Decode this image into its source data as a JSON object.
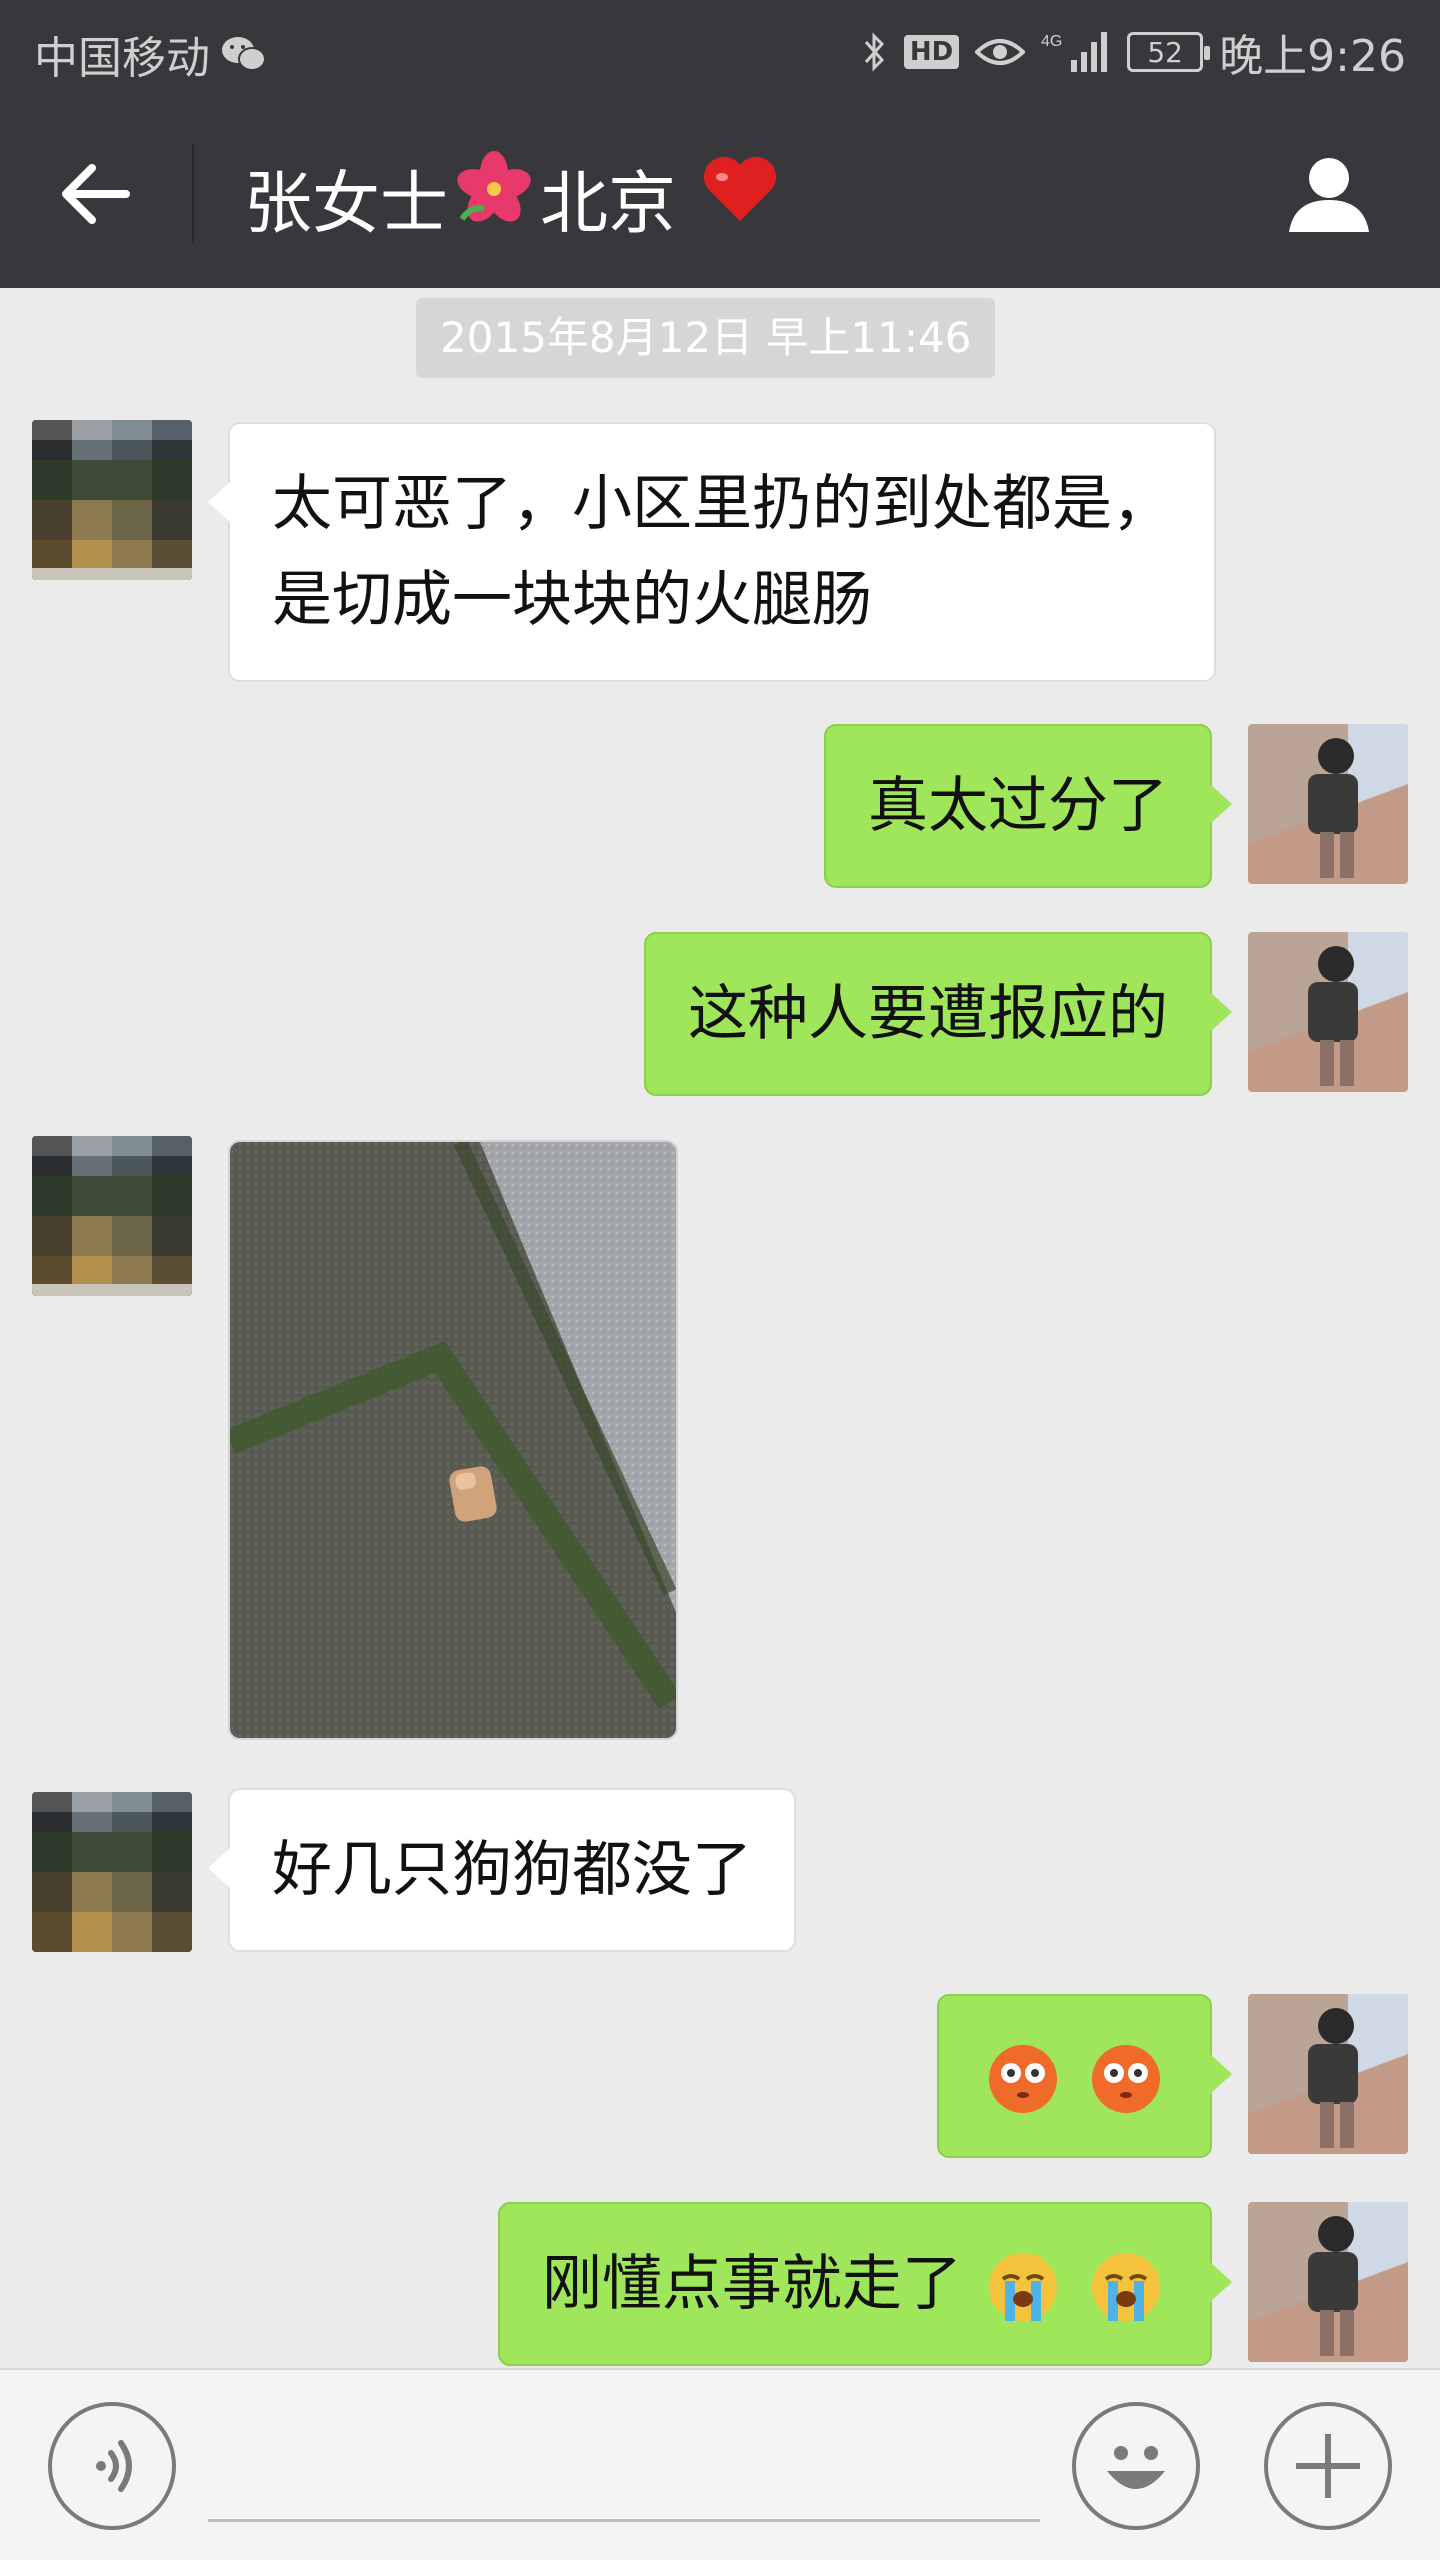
{
  "status_bar": {
    "carrier": "中国移动",
    "network": "4G",
    "battery": "52",
    "time": "晚上9:26",
    "icons": [
      "wechat-icon",
      "bluetooth-icon",
      "hd-icon",
      "eye-icon",
      "signal-icon",
      "battery-icon"
    ]
  },
  "header": {
    "title_part1": "张女士",
    "title_part2": "北京",
    "icons": [
      "back-arrow-icon",
      "hibiscus-icon",
      "heart-icon",
      "profile-icon"
    ]
  },
  "chat": {
    "timestamp": "2015年8月12日 早上11:46",
    "messages": [
      {
        "from": "contact",
        "line1": "太可恶了，小区里扔的到处都是，",
        "line2": "是切成一块块的火腿肠"
      },
      {
        "from": "me",
        "text": "真太过分了"
      },
      {
        "from": "me",
        "text": "这种人要遭报应的"
      },
      {
        "from": "contact",
        "type": "image",
        "description": "photo"
      },
      {
        "from": "contact",
        "text": "好几只狗狗都没了"
      },
      {
        "from": "me",
        "type": "emoji",
        "emojis": [
          "flushed-face-icon",
          "flushed-face-icon"
        ]
      },
      {
        "from": "me",
        "text": "刚懂点事就走了",
        "emojis": [
          "crying-face-icon",
          "crying-face-icon"
        ]
      }
    ]
  },
  "input_bar": {
    "icons": [
      "voice-icon",
      "emoji-icon",
      "plus-icon"
    ],
    "placeholder": ""
  },
  "colors": {
    "header_bg": "#38383c",
    "chat_bg": "#ebebeb",
    "outgoing_bubble": "#9fe65a",
    "incoming_bubble": "#ffffff"
  }
}
